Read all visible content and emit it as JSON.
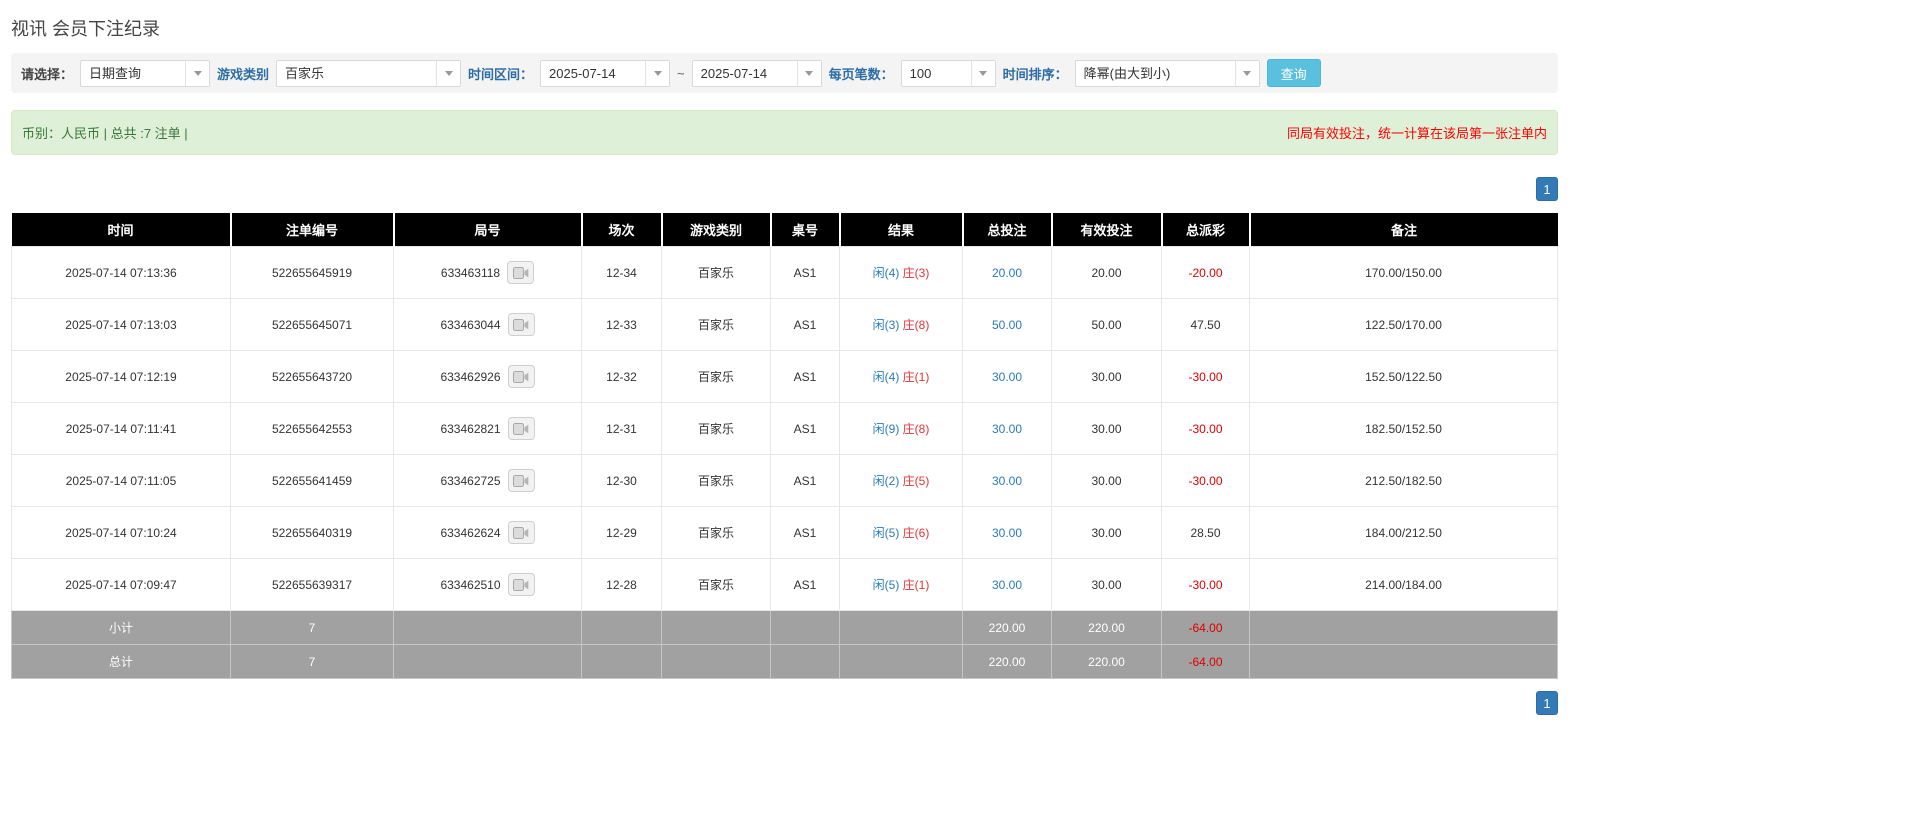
{
  "page": {
    "title": "视讯 会员下注纪录"
  },
  "filters": {
    "select_label": "请选择：",
    "select_value": "日期查询",
    "game_type_label": "游戏类别",
    "game_type_value": "百家乐",
    "time_range_label": "时间区间：",
    "date_from": "2025-07-14",
    "range_separator": "~",
    "date_to": "2025-07-14",
    "page_size_label": "每页笔数：",
    "page_size_value": "100",
    "sort_label": "时间排序：",
    "sort_value": "降幂(由大到小)",
    "query_button_label": "查询"
  },
  "notice": {
    "left": "币别：人民币 | 总共 :7 注单 |",
    "right": "同局有效投注，统一计算在该局第一张注单内"
  },
  "pagination": {
    "current_page": "1"
  },
  "colors": {
    "accent_blue": "#2a7ab9",
    "banker_red": "#e53333",
    "negative_red": "#dd0000",
    "query_button_bg": "#5bc0de",
    "table_header_bg": "#000000",
    "summary_row_bg": "#a1a1a1",
    "notice_bg": "#dff0d8",
    "pagination_bg": "#337ab7"
  },
  "table": {
    "headers": [
      "时间",
      "注单编号",
      "局号",
      "场次",
      "游戏类别",
      "桌号",
      "结果",
      "总投注",
      "有效投注",
      "总派彩",
      "备注"
    ],
    "rows": [
      {
        "time": "2025-07-14 07:13:36",
        "bet_id": "522655645919",
        "round_id": "633463118",
        "session": "12-34",
        "game": "百家乐",
        "table_no": "AS1",
        "result_player": "闲(4)",
        "result_banker": "庄(3)",
        "total_bet": "20.00",
        "valid_bet": "20.00",
        "payout": "-20.00",
        "remark": "170.00/150.00"
      },
      {
        "time": "2025-07-14 07:13:03",
        "bet_id": "522655645071",
        "round_id": "633463044",
        "session": "12-33",
        "game": "百家乐",
        "table_no": "AS1",
        "result_player": "闲(3)",
        "result_banker": "庄(8)",
        "total_bet": "50.00",
        "valid_bet": "50.00",
        "payout": "47.50",
        "remark": "122.50/170.00"
      },
      {
        "time": "2025-07-14 07:12:19",
        "bet_id": "522655643720",
        "round_id": "633462926",
        "session": "12-32",
        "game": "百家乐",
        "table_no": "AS1",
        "result_player": "闲(4)",
        "result_banker": "庄(1)",
        "total_bet": "30.00",
        "valid_bet": "30.00",
        "payout": "-30.00",
        "remark": "152.50/122.50"
      },
      {
        "time": "2025-07-14 07:11:41",
        "bet_id": "522655642553",
        "round_id": "633462821",
        "session": "12-31",
        "game": "百家乐",
        "table_no": "AS1",
        "result_player": "闲(9)",
        "result_banker": "庄(8)",
        "total_bet": "30.00",
        "valid_bet": "30.00",
        "payout": "-30.00",
        "remark": "182.50/152.50"
      },
      {
        "time": "2025-07-14 07:11:05",
        "bet_id": "522655641459",
        "round_id": "633462725",
        "session": "12-30",
        "game": "百家乐",
        "table_no": "AS1",
        "result_player": "闲(2)",
        "result_banker": "庄(5)",
        "total_bet": "30.00",
        "valid_bet": "30.00",
        "payout": "-30.00",
        "remark": "212.50/182.50"
      },
      {
        "time": "2025-07-14 07:10:24",
        "bet_id": "522655640319",
        "round_id": "633462624",
        "session": "12-29",
        "game": "百家乐",
        "table_no": "AS1",
        "result_player": "闲(5)",
        "result_banker": "庄(6)",
        "total_bet": "30.00",
        "valid_bet": "30.00",
        "payout": "28.50",
        "remark": "184.00/212.50"
      },
      {
        "time": "2025-07-14 07:09:47",
        "bet_id": "522655639317",
        "round_id": "633462510",
        "session": "12-28",
        "game": "百家乐",
        "table_no": "AS1",
        "result_player": "闲(5)",
        "result_banker": "庄(1)",
        "total_bet": "30.00",
        "valid_bet": "30.00",
        "payout": "-30.00",
        "remark": "214.00/184.00"
      }
    ],
    "subtotal_row": {
      "label": "小计",
      "count": "7",
      "total_bet": "220.00",
      "valid_bet": "220.00",
      "payout": "-64.00"
    },
    "total_row": {
      "label": "总计",
      "count": "7",
      "total_bet": "220.00",
      "valid_bet": "220.00",
      "payout": "-64.00"
    }
  }
}
